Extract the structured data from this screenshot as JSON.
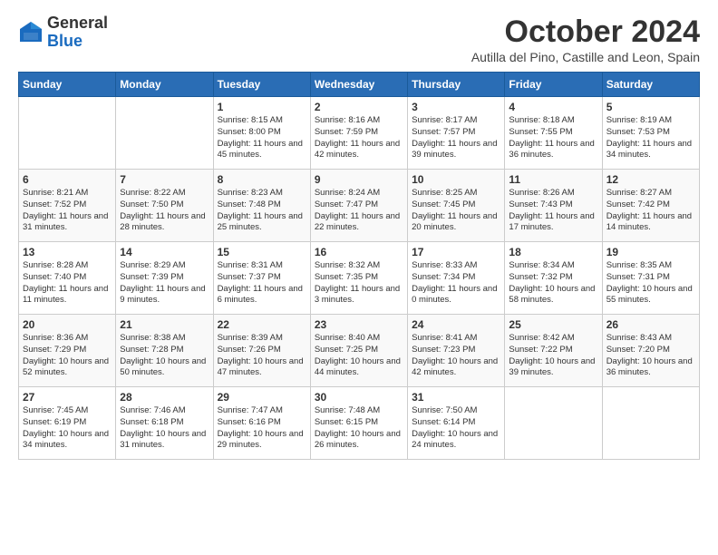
{
  "logo": {
    "general": "General",
    "blue": "Blue"
  },
  "header": {
    "month": "October 2024",
    "location": "Autilla del Pino, Castille and Leon, Spain"
  },
  "weekdays": [
    "Sunday",
    "Monday",
    "Tuesday",
    "Wednesday",
    "Thursday",
    "Friday",
    "Saturday"
  ],
  "weeks": [
    [
      {
        "day": "",
        "detail": ""
      },
      {
        "day": "",
        "detail": ""
      },
      {
        "day": "1",
        "detail": "Sunrise: 8:15 AM\nSunset: 8:00 PM\nDaylight: 11 hours and 45 minutes."
      },
      {
        "day": "2",
        "detail": "Sunrise: 8:16 AM\nSunset: 7:59 PM\nDaylight: 11 hours and 42 minutes."
      },
      {
        "day": "3",
        "detail": "Sunrise: 8:17 AM\nSunset: 7:57 PM\nDaylight: 11 hours and 39 minutes."
      },
      {
        "day": "4",
        "detail": "Sunrise: 8:18 AM\nSunset: 7:55 PM\nDaylight: 11 hours and 36 minutes."
      },
      {
        "day": "5",
        "detail": "Sunrise: 8:19 AM\nSunset: 7:53 PM\nDaylight: 11 hours and 34 minutes."
      }
    ],
    [
      {
        "day": "6",
        "detail": "Sunrise: 8:21 AM\nSunset: 7:52 PM\nDaylight: 11 hours and 31 minutes."
      },
      {
        "day": "7",
        "detail": "Sunrise: 8:22 AM\nSunset: 7:50 PM\nDaylight: 11 hours and 28 minutes."
      },
      {
        "day": "8",
        "detail": "Sunrise: 8:23 AM\nSunset: 7:48 PM\nDaylight: 11 hours and 25 minutes."
      },
      {
        "day": "9",
        "detail": "Sunrise: 8:24 AM\nSunset: 7:47 PM\nDaylight: 11 hours and 22 minutes."
      },
      {
        "day": "10",
        "detail": "Sunrise: 8:25 AM\nSunset: 7:45 PM\nDaylight: 11 hours and 20 minutes."
      },
      {
        "day": "11",
        "detail": "Sunrise: 8:26 AM\nSunset: 7:43 PM\nDaylight: 11 hours and 17 minutes."
      },
      {
        "day": "12",
        "detail": "Sunrise: 8:27 AM\nSunset: 7:42 PM\nDaylight: 11 hours and 14 minutes."
      }
    ],
    [
      {
        "day": "13",
        "detail": "Sunrise: 8:28 AM\nSunset: 7:40 PM\nDaylight: 11 hours and 11 minutes."
      },
      {
        "day": "14",
        "detail": "Sunrise: 8:29 AM\nSunset: 7:39 PM\nDaylight: 11 hours and 9 minutes."
      },
      {
        "day": "15",
        "detail": "Sunrise: 8:31 AM\nSunset: 7:37 PM\nDaylight: 11 hours and 6 minutes."
      },
      {
        "day": "16",
        "detail": "Sunrise: 8:32 AM\nSunset: 7:35 PM\nDaylight: 11 hours and 3 minutes."
      },
      {
        "day": "17",
        "detail": "Sunrise: 8:33 AM\nSunset: 7:34 PM\nDaylight: 11 hours and 0 minutes."
      },
      {
        "day": "18",
        "detail": "Sunrise: 8:34 AM\nSunset: 7:32 PM\nDaylight: 10 hours and 58 minutes."
      },
      {
        "day": "19",
        "detail": "Sunrise: 8:35 AM\nSunset: 7:31 PM\nDaylight: 10 hours and 55 minutes."
      }
    ],
    [
      {
        "day": "20",
        "detail": "Sunrise: 8:36 AM\nSunset: 7:29 PM\nDaylight: 10 hours and 52 minutes."
      },
      {
        "day": "21",
        "detail": "Sunrise: 8:38 AM\nSunset: 7:28 PM\nDaylight: 10 hours and 50 minutes."
      },
      {
        "day": "22",
        "detail": "Sunrise: 8:39 AM\nSunset: 7:26 PM\nDaylight: 10 hours and 47 minutes."
      },
      {
        "day": "23",
        "detail": "Sunrise: 8:40 AM\nSunset: 7:25 PM\nDaylight: 10 hours and 44 minutes."
      },
      {
        "day": "24",
        "detail": "Sunrise: 8:41 AM\nSunset: 7:23 PM\nDaylight: 10 hours and 42 minutes."
      },
      {
        "day": "25",
        "detail": "Sunrise: 8:42 AM\nSunset: 7:22 PM\nDaylight: 10 hours and 39 minutes."
      },
      {
        "day": "26",
        "detail": "Sunrise: 8:43 AM\nSunset: 7:20 PM\nDaylight: 10 hours and 36 minutes."
      }
    ],
    [
      {
        "day": "27",
        "detail": "Sunrise: 7:45 AM\nSunset: 6:19 PM\nDaylight: 10 hours and 34 minutes."
      },
      {
        "day": "28",
        "detail": "Sunrise: 7:46 AM\nSunset: 6:18 PM\nDaylight: 10 hours and 31 minutes."
      },
      {
        "day": "29",
        "detail": "Sunrise: 7:47 AM\nSunset: 6:16 PM\nDaylight: 10 hours and 29 minutes."
      },
      {
        "day": "30",
        "detail": "Sunrise: 7:48 AM\nSunset: 6:15 PM\nDaylight: 10 hours and 26 minutes."
      },
      {
        "day": "31",
        "detail": "Sunrise: 7:50 AM\nSunset: 6:14 PM\nDaylight: 10 hours and 24 minutes."
      },
      {
        "day": "",
        "detail": ""
      },
      {
        "day": "",
        "detail": ""
      }
    ]
  ]
}
